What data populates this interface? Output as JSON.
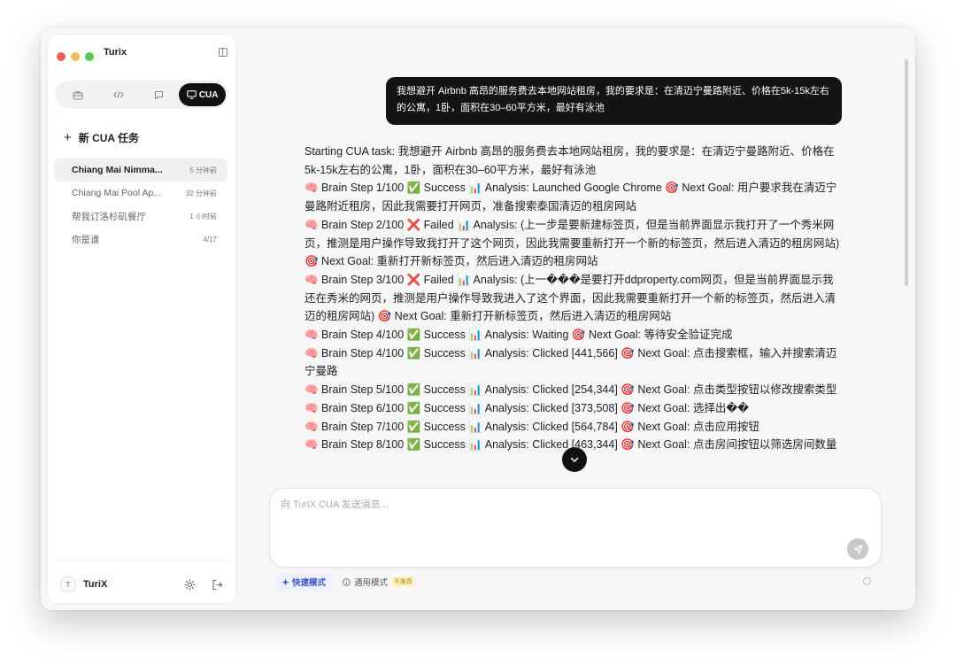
{
  "colors": {
    "accent": "#3b55d6",
    "dark": "#111111",
    "traffic_red": "#ee5f57",
    "traffic_yellow": "#f5bd4f",
    "traffic_green": "#5ec754",
    "warning_badge": "#fff3c9"
  },
  "app": {
    "title": "Turix"
  },
  "sidebar": {
    "mode_tabs": [
      {
        "icon": "briefcase-icon",
        "label": ""
      },
      {
        "icon": "code-icon",
        "label": ""
      },
      {
        "icon": "chat-icon",
        "label": ""
      },
      {
        "icon": "monitor-icon",
        "label": "CUA"
      }
    ],
    "active_mode": "CUA",
    "new_task_label": "新 CUA 任务",
    "sessions": [
      {
        "title": "Chiang Mai Nimma...",
        "time": "5 分钟前",
        "active": true
      },
      {
        "title": "Chiang Mai Pool Ap...",
        "time": "32 分钟前",
        "active": false
      },
      {
        "title": "帮我订洛杉矶餐厅",
        "time": "1 小时前",
        "active": false
      },
      {
        "title": "你是谁",
        "time": "4/17",
        "active": false
      }
    ],
    "user": {
      "initial": "T",
      "name": "TuriX"
    }
  },
  "chat": {
    "user_message": "我想避开 Airbnb 高昂的服务费去本地网站租房，我的要求是：在清迈宁曼路附近、价格在5k-15k左右的公寓，1卧，面积在30–60平方米，最好有泳池",
    "log_lines": [
      "Starting CUA task: 我想避开 Airbnb 高昂的服务费去本地网站租房，我的要求是：在清迈宁曼路附近、价格在5k-15k左右的公寓，1卧，面积在30–60平方米，最好有泳池",
      "🧠 Brain Step 1/100 ✅ Success 📊 Analysis: Launched Google Chrome 🎯 Next Goal: 用户要求我在清迈宁曼路附近租房，因此我需要打开网页，准备搜索泰国清迈的租房网站",
      "🧠 Brain Step 2/100 ❌ Failed 📊 Analysis: (上一步是要新建标签页，但是当前界面显示我打开了一个秀米网页，推测是用户操作导致我打开了这个网页，因此我需要重新打开一个新的标签页，然后进入清迈的租房网站) 🎯 Next Goal: 重新打开新标签页，然后进入清迈的租房网站",
      "🧠 Brain Step 3/100 ❌ Failed 📊 Analysis: (上一���是要打开ddproperty.com网页，但是当前界面显示我还在秀米的网页，推测是用户操作导致我进入了这个界面，因此我需要重新打开一个新的标签页，然后进入清迈的租房网站) 🎯 Next Goal: 重新打开新标签页，然后进入清迈的租房网站",
      "🧠 Brain Step 4/100 ✅ Success 📊 Analysis: Waiting 🎯 Next Goal: 等待安全验证完成",
      "🧠 Brain Step 4/100 ✅ Success 📊 Analysis: Clicked [441,566] 🎯 Next Goal: 点击搜索框，输入并搜索清迈宁曼路",
      "🧠 Brain Step 5/100 ✅ Success 📊 Analysis: Clicked [254,344] 🎯 Next Goal: 点击类型按钮以修改搜索类型",
      "🧠 Brain Step 6/100 ✅ Success 📊 Analysis: Clicked [373,508] 🎯 Next Goal: 选择出��",
      "🧠 Brain Step 7/100 ✅ Success 📊 Analysis: Clicked [564,784] 🎯 Next Goal: 点击应用按钮",
      "🧠 Brain Step 8/100 ✅ Success 📊 Analysis: Clicked [463,344] 🎯 Next Goal: 点击房间按钮以筛选房间数量"
    ]
  },
  "composer": {
    "placeholder": "向 TuriX CUA 发送消息...",
    "value": "",
    "fast_mode_label": "快速模式",
    "general_mode_label": "通用模式",
    "general_mode_badge": "不推荐"
  }
}
